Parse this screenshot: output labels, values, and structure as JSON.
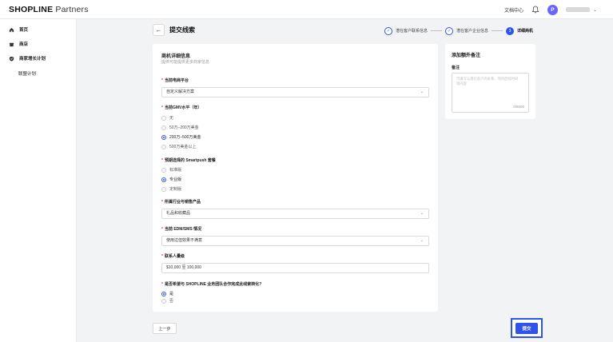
{
  "brand": {
    "logo_bold": "SHOPLINE",
    "logo_light": " Partners"
  },
  "header": {
    "doc_center": "文档中心",
    "avatar_initial": "P"
  },
  "sidebar": {
    "items": [
      {
        "label": "首页",
        "icon": "home-icon"
      },
      {
        "label": "商店",
        "icon": "store-icon"
      },
      {
        "label": "商家增长计划",
        "icon": "shield-icon"
      }
    ],
    "sub_items": [
      {
        "label": "联盟计划"
      }
    ]
  },
  "page": {
    "title": "提交线索"
  },
  "steps": [
    {
      "label": "潜在客户联系信息",
      "status": "done"
    },
    {
      "label": "潜在客户企业信息",
      "status": "done"
    },
    {
      "label": "详细商机",
      "number": "3",
      "status": "active"
    }
  ],
  "form": {
    "section_title": "商机详细信息",
    "section_subtitle": "提供可能提供更多商家信息",
    "platform": {
      "label": "当前电商平台",
      "value": "自定义解决方案"
    },
    "gmv": {
      "label": "当前GMV水平（年）",
      "options": [
        "无",
        "50万–200万美金",
        "200万–500万美金",
        "500万美金以上"
      ],
      "selected": "200万–500万美金"
    },
    "smartpush": {
      "label": "预期选择的 Smartpush 套餐",
      "options": [
        "标准版",
        "专业版",
        "定制版"
      ],
      "selected": "专业版"
    },
    "industry": {
      "label": "所属行业与销售产品",
      "value": "礼品和收藏品"
    },
    "edm": {
      "label": "当前 EDM/SMS 情况",
      "value": "使用过但效果不满意"
    },
    "contacts": {
      "label": "联系人量级",
      "value": "$10,000 至 100,000"
    },
    "collab": {
      "label": "是否希望与 SHOPLINE 业务团队合作完成此线索转化?",
      "options": [
        "是",
        "否"
      ],
      "selected": "是"
    }
  },
  "notes": {
    "title": "添加额外备注",
    "label": "备注",
    "placeholder": "可填写与潜在客户的关系、项目后续时间等内容",
    "counter": "0/5000"
  },
  "footer": {
    "prev_label": "上一步",
    "submit_label": "提交"
  },
  "colors": {
    "primary": "#2f54eb",
    "required": "#f5222d",
    "avatar": "#6c63ff"
  }
}
